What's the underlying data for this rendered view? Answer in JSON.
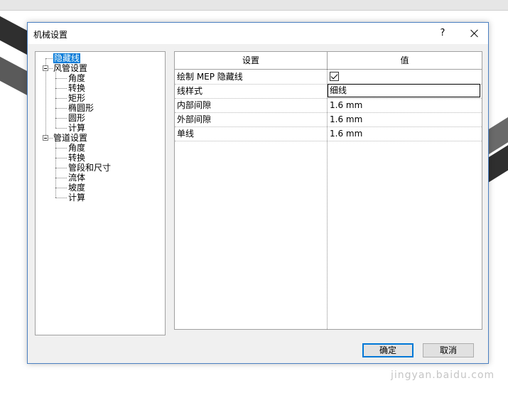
{
  "dialog": {
    "title": "机械设置",
    "help_label": "?",
    "close_label": "",
    "ok_label": "确定",
    "cancel_label": "取消"
  },
  "tree": {
    "items": [
      {
        "label": "隐藏线",
        "level": 0,
        "selected": true
      },
      {
        "label": "风管设置",
        "level": 0
      },
      {
        "label": "角度",
        "level": 1
      },
      {
        "label": "转换",
        "level": 1
      },
      {
        "label": "矩形",
        "level": 1
      },
      {
        "label": "椭圆形",
        "level": 1
      },
      {
        "label": "圆形",
        "level": 1
      },
      {
        "label": "计算",
        "level": 1
      },
      {
        "label": "管道设置",
        "level": 0
      },
      {
        "label": "角度",
        "level": 1
      },
      {
        "label": "转换",
        "level": 1
      },
      {
        "label": "管段和尺寸",
        "level": 1
      },
      {
        "label": "流体",
        "level": 1
      },
      {
        "label": "坡度",
        "level": 1
      },
      {
        "label": "计算",
        "level": 1
      }
    ]
  },
  "grid": {
    "header_setting": "设置",
    "header_value": "值",
    "rows": [
      {
        "setting": "绘制 MEP 隐藏线",
        "value": "",
        "checked": true
      },
      {
        "setting": "线样式",
        "value": "细线"
      },
      {
        "setting": "内部间隙",
        "value": "1.6 mm"
      },
      {
        "setting": "外部间隙",
        "value": "1.6 mm"
      },
      {
        "setting": "单线",
        "value": "1.6 mm"
      }
    ]
  },
  "watermark": "jingyan.baidu.com"
}
